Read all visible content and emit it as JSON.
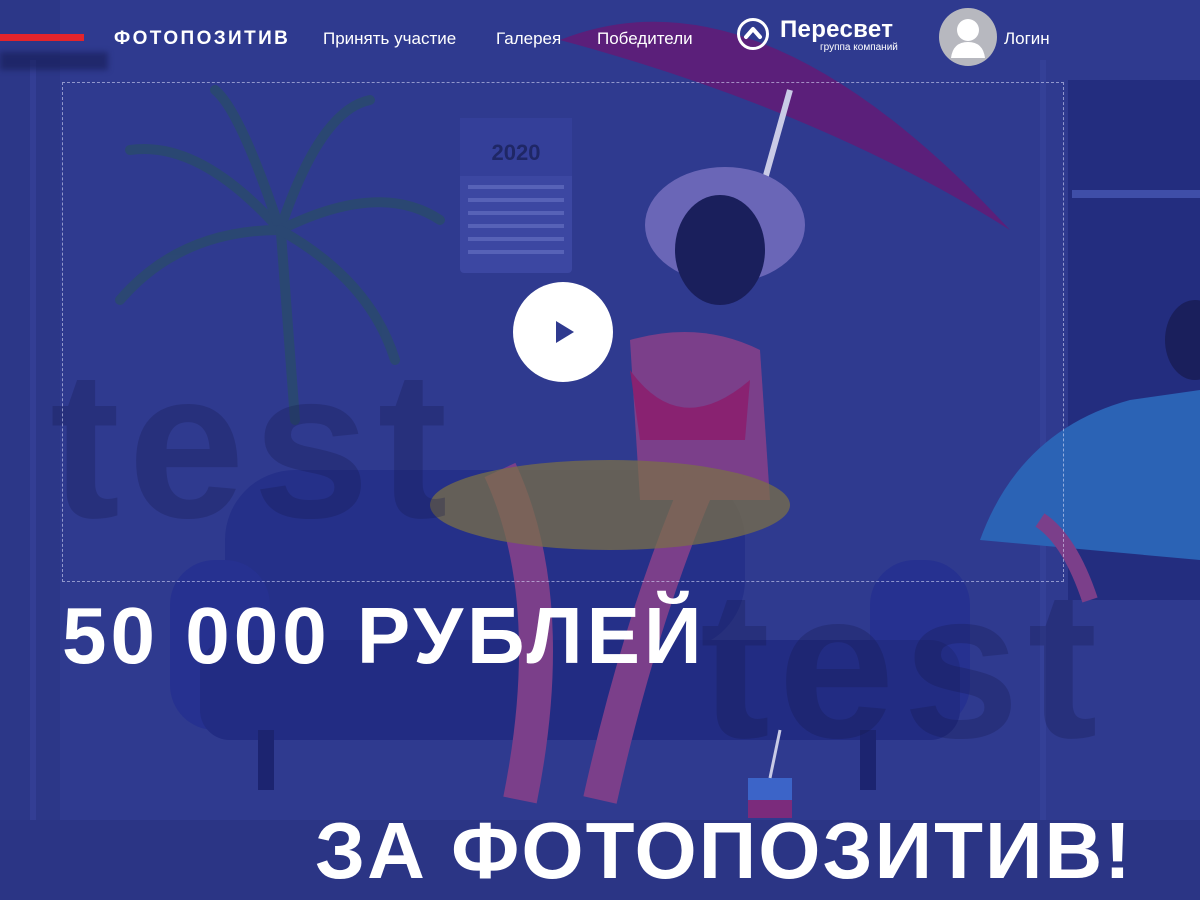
{
  "header": {
    "brand": "ФОТОПОЗИТИВ",
    "nav": [
      "Принять участие",
      "Галерея",
      "Победители"
    ],
    "partner_logo": {
      "name": "Пересвет",
      "subtitle": "группа компаний"
    },
    "login_label": "Логин"
  },
  "hero": {
    "calendar_year": "2020",
    "watermark": "test",
    "headline_1": "50 000 РУБЛЕЙ",
    "headline_2": "ЗА ФОТОПОЗИТИВ!"
  },
  "icons": {
    "play": "play-icon",
    "avatar": "user-icon",
    "logo": "chevron-up-circle-icon"
  },
  "colors": {
    "background": "#2f3a8f",
    "accent": "#e3242b",
    "umbrella": "#5b1f7a",
    "text": "#ffffff",
    "avatar": "#b7b8bf"
  }
}
